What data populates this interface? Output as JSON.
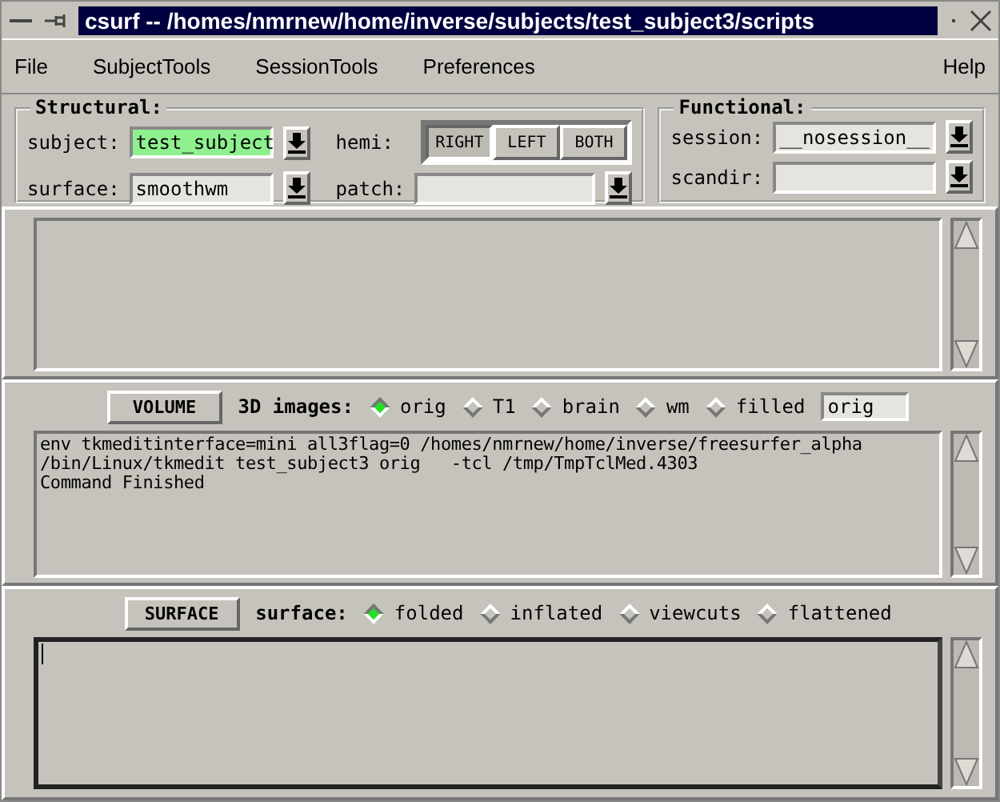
{
  "window": {
    "title": "csurf -- /homes/nmrnew/home/inverse/subjects/test_subject3/scripts"
  },
  "menu": {
    "items": [
      "File",
      "SubjectTools",
      "SessionTools",
      "Preferences"
    ],
    "right_item": "Help"
  },
  "structural": {
    "title": "Structural:",
    "fields": [
      {
        "label": "subject:",
        "value": "test_subject",
        "highlighted": true
      },
      {
        "label": "surface:",
        "value": "smoothwm",
        "highlighted": false
      }
    ],
    "hemi": {
      "label": "hemi:",
      "options": [
        {
          "label": "RIGHT",
          "selected": true
        },
        {
          "label": "LEFT",
          "selected": false
        },
        {
          "label": "BOTH",
          "selected": false
        }
      ]
    },
    "patch": {
      "label": "patch:"
    }
  },
  "functional": {
    "title": "Functional:",
    "fields": [
      {
        "label": "session:",
        "value": "__nosession__"
      },
      {
        "label": "scandir:"
      }
    ]
  },
  "volume": {
    "button": "VOLUME",
    "label": "3D images:",
    "options": [
      {
        "label": "orig",
        "selected": true
      },
      {
        "label": "T1",
        "selected": false
      },
      {
        "label": "brain",
        "selected": false
      },
      {
        "label": "wm",
        "selected": false
      },
      {
        "label": "filled",
        "selected": false
      }
    ],
    "entry": "orig",
    "log": [
      "env tkmeditinterface=mini all3flag=0 /homes/nmrnew/home/inverse/freesurfer_alpha",
      "/bin/Linux/tkmedit test_subject3 orig   -tcl /tmp/TmpTclMed.4303",
      "Command Finished"
    ]
  },
  "surface": {
    "button": "SURFACE",
    "label": "surface:",
    "options": [
      {
        "label": "folded",
        "selected": true
      },
      {
        "label": "inflated",
        "selected": false
      },
      {
        "label": "viewcuts",
        "selected": false
      },
      {
        "label": "flattened",
        "selected": false
      }
    ]
  }
}
